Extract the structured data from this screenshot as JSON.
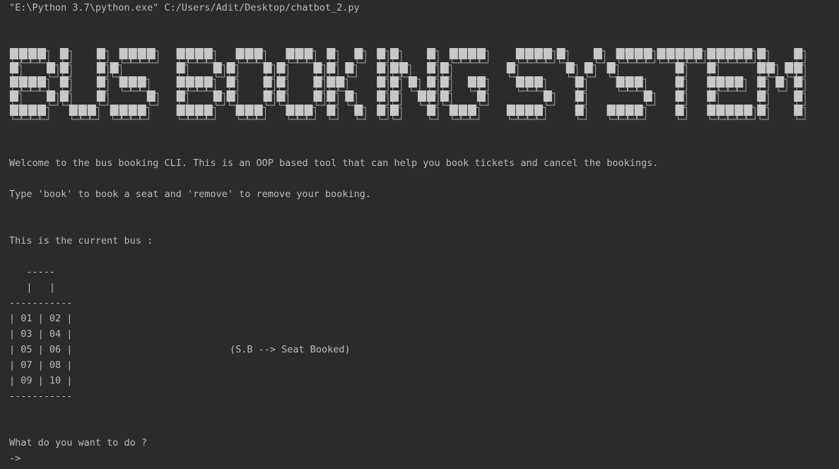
{
  "console": {
    "command": "\"E:\\Python 3.7\\python.exe\" C:/Users/Adit/Desktop/chatbot_2.py",
    "welcome": "Welcome to the bus booking CLI. This is an OOP based tool that can help you book tickets and cancel the bookings.",
    "instructions": "Type 'book' to book a seat and 'remove' to remove your booking.",
    "current_bus_label": "This is the current bus :",
    "prompt_question": "What do you want to do ?",
    "prompt_symbol": "->",
    "input_value": ""
  },
  "banner": {
    "text": "BUS BOOKING SYSTEM",
    "letters": [
      "B",
      "U",
      "S",
      "B",
      "O",
      "O",
      "K",
      "I",
      "N",
      "G",
      "S",
      "Y",
      "S",
      "T",
      "E",
      "M"
    ],
    "block_color": "#c8c8c8",
    "outline_color": "#a8a8a8"
  },
  "bus": {
    "roof": "   -----",
    "door": "   |   |",
    "divider": "-----------",
    "rows": [
      "| 01 | 02 |",
      "| 03 | 04 |",
      "| 05 | 06 |",
      "| 07 | 08 |",
      "| 09 | 10 |"
    ],
    "legend": "(S.B --> Seat Booked)"
  },
  "theme": {
    "background": "#2b2b2b",
    "text": "#bbbbbb"
  }
}
